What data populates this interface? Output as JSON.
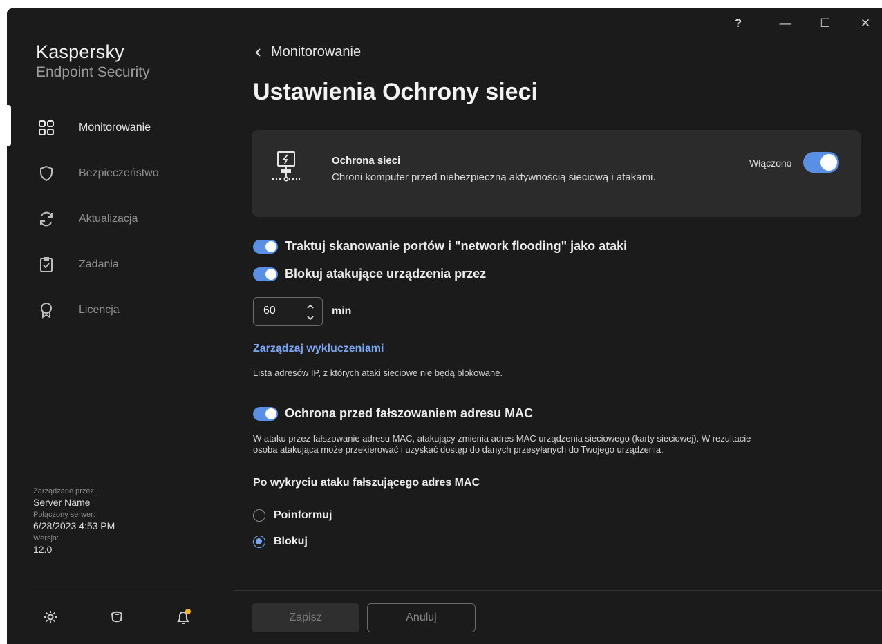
{
  "app": {
    "brand_name": "Kaspersky",
    "brand_product": "Endpoint Security"
  },
  "titlebar": {
    "help": "?",
    "minimize": "—",
    "maximize": "☐",
    "close": "✕"
  },
  "sidebar": {
    "items": [
      {
        "label": "Monitorowanie",
        "icon": "dashboard-grid-icon",
        "active": true
      },
      {
        "label": "Bezpieczeństwo",
        "icon": "shield-icon",
        "active": false
      },
      {
        "label": "Aktualizacja",
        "icon": "refresh-icon",
        "active": false
      },
      {
        "label": "Zadania",
        "icon": "clipboard-check-icon",
        "active": false
      },
      {
        "label": "Licencja",
        "icon": "license-badge-icon",
        "active": false
      }
    ],
    "meta": {
      "managed_by_label": "Zarządzane przez:",
      "managed_by_value": "Server Name",
      "connected_label": "Połączony serwer:",
      "connected_value": "6/28/2023 4:53 PM",
      "version_label": "Wersja:",
      "version_value": "12.0"
    },
    "bottom_icons": [
      "settings-gear-icon",
      "support-icon",
      "notifications-bell-icon"
    ],
    "notification_dot_color": "#f0b429"
  },
  "main": {
    "back_label": "Monitorowanie",
    "page_title": "Ustawienia Ochrony sieci",
    "card": {
      "title": "Ochrona sieci",
      "description": "Chroni komputer przed niebezpieczną aktywnością sieciową i atakami.",
      "state_label": "Włączono",
      "enabled": true
    },
    "options": {
      "port_scan_label": "Traktuj skanowanie portów i \"network flooding\" jako ataki",
      "port_scan_enabled": true,
      "block_label": "Blokuj atakujące urządzenia przez",
      "block_enabled": true,
      "block_minutes": "60",
      "block_unit": "min"
    },
    "exclusions": {
      "link": "Zarządzaj wykluczeniami",
      "description": "Lista adresów IP, z których ataki sieciowe nie będą blokowane."
    },
    "mac": {
      "label": "Ochrona przed fałszowaniem adresu MAC",
      "enabled": true,
      "description_line1": "W ataku przez fałszowanie adresu MAC, atakujący zmienia adres MAC urządzenia sieciowego (karty sieciowej). W rezultacie",
      "description_line2": "osoba atakująca może przekierować i uzyskać dostęp do danych przesyłanych do Twojego urządzenia.",
      "subheading": "Po wykryciu ataku fałszującego adres MAC",
      "radio_notify": "Poinformuj",
      "radio_block": "Blokuj",
      "selected": "Blokuj"
    },
    "footer": {
      "save_label": "Zapisz",
      "cancel_label": "Anuluj"
    }
  },
  "colors": {
    "accent": "#5a8fe6",
    "link": "#7ba7f0",
    "background": "#1b1b1b",
    "card": "#2b2b2b"
  }
}
